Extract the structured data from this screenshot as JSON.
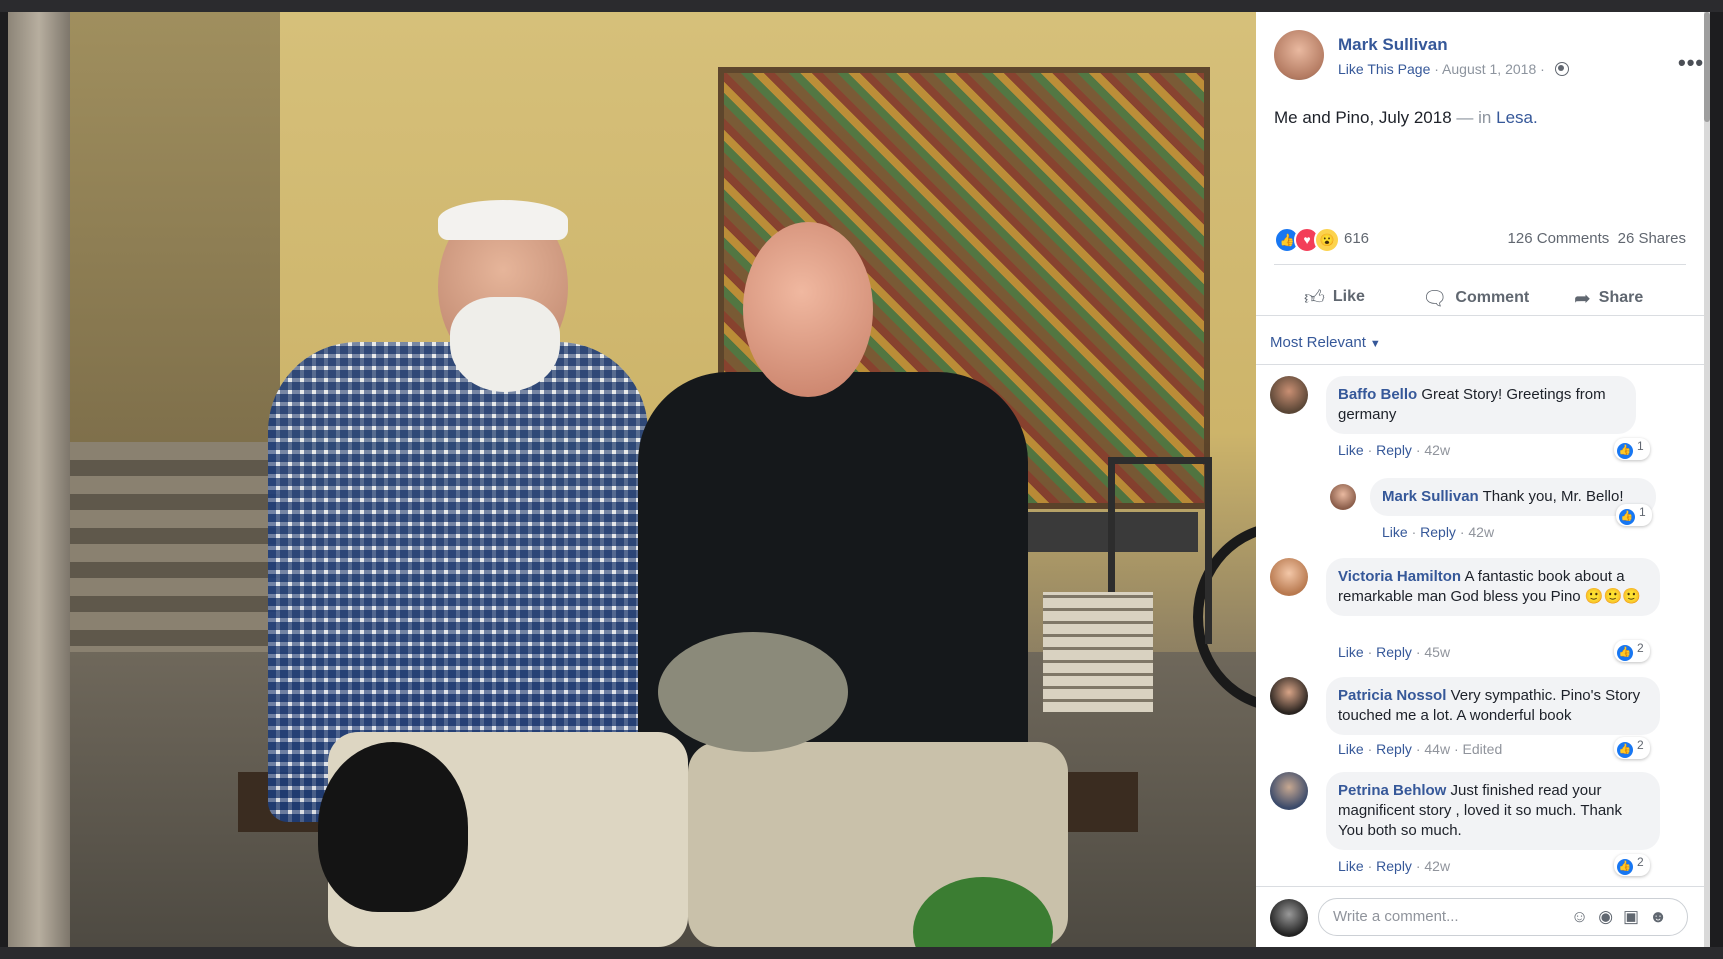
{
  "post": {
    "author": "Mark Sullivan",
    "like_page": "Like This Page",
    "separator": "·",
    "date": "August 1, 2018",
    "caption_text": "Me and Pino, July 2018",
    "caption_in": "— in",
    "caption_place": "Lesa.",
    "reaction_count": "616",
    "comments_count": "126 Comments",
    "shares_count": "26 Shares",
    "more_label": "•••"
  },
  "actions": {
    "like": "Like",
    "comment": "Comment",
    "share": "Share"
  },
  "sort": {
    "label": "Most Relevant",
    "caret": "▼"
  },
  "comments": [
    {
      "name": "Baffo Bello",
      "text": "Great Story! Greetings from germany",
      "like": "Like",
      "reply": "Reply",
      "time": "42w",
      "edited": "",
      "reactions": "1"
    },
    {
      "name": "Mark Sullivan",
      "text": "Thank you, Mr. Bello!",
      "like": "Like",
      "reply": "Reply",
      "time": "42w",
      "edited": "",
      "reactions": "1"
    },
    {
      "name": "Victoria Hamilton",
      "text": "A fantastic book about a remarkable man God bless you Pino 🙂🙂🙂",
      "like": "Like",
      "reply": "Reply",
      "time": "45w",
      "edited": "",
      "reactions": "2"
    },
    {
      "name": "Patricia Nossol",
      "text": "Very sympathic. Pino's Story touched me a lot. A wonderful book",
      "like": "Like",
      "reply": "Reply",
      "time": "44w",
      "edited": "Edited",
      "reactions": "2"
    },
    {
      "name": "Petrina Behlow",
      "text": "Just finished read your magnificent story , loved it so much. Thank You both so much.",
      "like": "Like",
      "reply": "Reply",
      "time": "42w",
      "edited": "",
      "reactions": "2"
    }
  ],
  "write": {
    "placeholder": "Write a comment..."
  },
  "icons": {
    "like": "like-icon",
    "comment": "comment-icon",
    "share": "share-icon",
    "emoji": "emoji-icon",
    "camera": "camera-icon",
    "gif": "gif-icon",
    "sticker": "sticker-icon",
    "globe": "globe-icon"
  },
  "colors": {
    "link": "#365899",
    "like_blue": "#1877f2",
    "love_red": "#f33e58",
    "wow_yellow": "#fcd34d",
    "bubble_bg": "#f2f3f5"
  }
}
